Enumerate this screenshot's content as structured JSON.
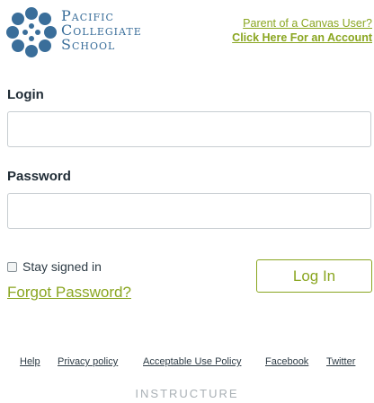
{
  "logo": {
    "line1": "Pacific",
    "line2": "Collegiate",
    "line3": "School"
  },
  "parent_link": {
    "line1": "Parent of a Canvas User?",
    "line2": "Click Here For an Account"
  },
  "login": {
    "label": "Login",
    "value": ""
  },
  "password": {
    "label": "Password",
    "value": ""
  },
  "stay_signed_in": {
    "label": "Stay signed in",
    "checked": false
  },
  "forgot_password": "Forgot Password?",
  "login_button": "Log In",
  "footer": {
    "links": [
      "Help",
      "Privacy policy",
      "Acceptable Use Policy",
      "Facebook",
      "Twitter"
    ],
    "brand": "INSTRUCTURE"
  },
  "colors": {
    "accent": "#8aa621",
    "logo_blue": "#3a6e9a"
  }
}
